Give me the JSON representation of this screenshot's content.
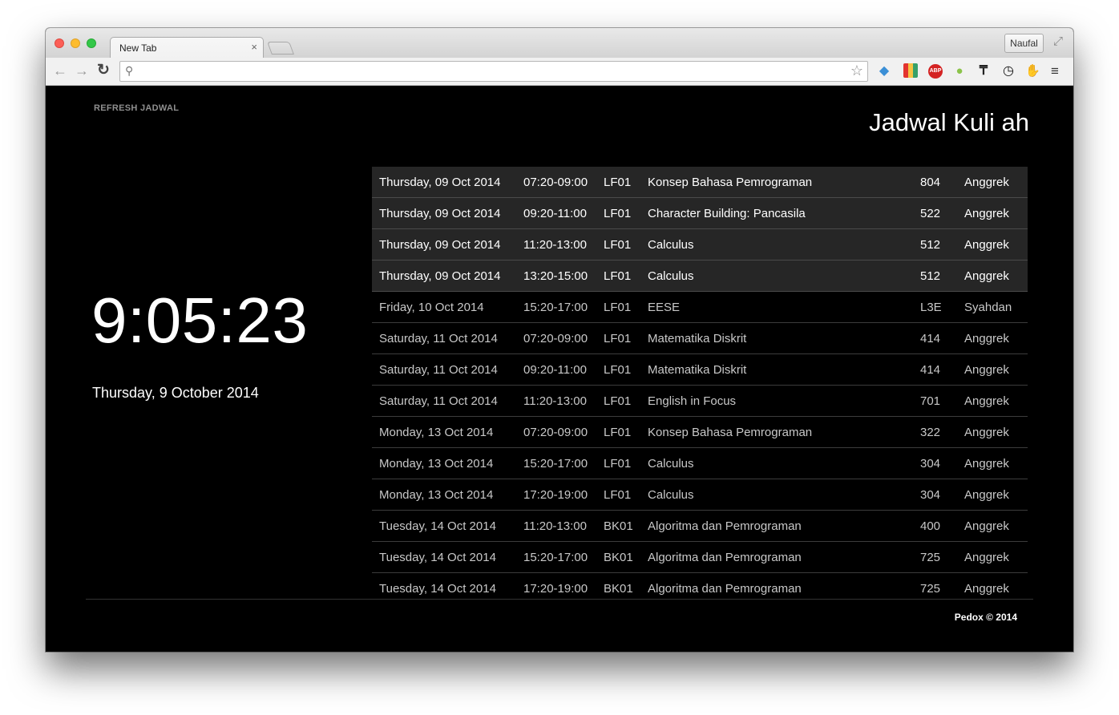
{
  "browser": {
    "tab_title": "New Tab",
    "tab_close": "×",
    "profile_name": "Naufal",
    "address": "",
    "icons": [
      "back-arrow-icon",
      "forward-arrow-icon",
      "reload-icon",
      "search-icon",
      "bookmark-star-icon",
      "fish-extension-icon",
      "grid-extension-icon",
      "adblock-plus-icon",
      "android-icon",
      "tree-extension-icon",
      "clock-extension-icon",
      "hand-extension-icon",
      "menu-icon",
      "fullscreen-icon"
    ],
    "abp_label": "ABP"
  },
  "page": {
    "refresh_label": "REFRESH JADWAL",
    "title": "Jadwal Kuli ah",
    "clock": "9:05:23",
    "date": "Thursday, 9 October 2014",
    "footer": "Pedox © 2014"
  },
  "schedule": [
    {
      "date": "Thursday, 09 Oct 2014",
      "time": "07:20-09:00",
      "class": "LF01",
      "course": "Konsep Bahasa Pemrograman",
      "room": "804",
      "building": "Anggrek",
      "past": true
    },
    {
      "date": "Thursday, 09 Oct 2014",
      "time": "09:20-11:00",
      "class": "LF01",
      "course": "Character Building: Pancasila",
      "room": "522",
      "building": "Anggrek",
      "past": true
    },
    {
      "date": "Thursday, 09 Oct 2014",
      "time": "11:20-13:00",
      "class": "LF01",
      "course": "Calculus",
      "room": "512",
      "building": "Anggrek",
      "past": true
    },
    {
      "date": "Thursday, 09 Oct 2014",
      "time": "13:20-15:00",
      "class": "LF01",
      "course": "Calculus",
      "room": "512",
      "building": "Anggrek",
      "past": true
    },
    {
      "date": "Friday, 10 Oct 2014",
      "time": "15:20-17:00",
      "class": "LF01",
      "course": "EESE",
      "room": "L3E",
      "building": "Syahdan",
      "past": false
    },
    {
      "date": "Saturday, 11 Oct 2014",
      "time": "07:20-09:00",
      "class": "LF01",
      "course": "Matematika Diskrit",
      "room": "414",
      "building": "Anggrek",
      "past": false
    },
    {
      "date": "Saturday, 11 Oct 2014",
      "time": "09:20-11:00",
      "class": "LF01",
      "course": "Matematika Diskrit",
      "room": "414",
      "building": "Anggrek",
      "past": false
    },
    {
      "date": "Saturday, 11 Oct 2014",
      "time": "11:20-13:00",
      "class": "LF01",
      "course": "English in Focus",
      "room": "701",
      "building": "Anggrek",
      "past": false
    },
    {
      "date": "Monday, 13 Oct 2014",
      "time": "07:20-09:00",
      "class": "LF01",
      "course": "Konsep Bahasa Pemrograman",
      "room": "322",
      "building": "Anggrek",
      "past": false
    },
    {
      "date": "Monday, 13 Oct 2014",
      "time": "15:20-17:00",
      "class": "LF01",
      "course": "Calculus",
      "room": "304",
      "building": "Anggrek",
      "past": false
    },
    {
      "date": "Monday, 13 Oct 2014",
      "time": "17:20-19:00",
      "class": "LF01",
      "course": "Calculus",
      "room": "304",
      "building": "Anggrek",
      "past": false
    },
    {
      "date": "Tuesday, 14 Oct 2014",
      "time": "11:20-13:00",
      "class": "BK01",
      "course": "Algoritma dan Pemrograman",
      "room": "400",
      "building": "Anggrek",
      "past": false
    },
    {
      "date": "Tuesday, 14 Oct 2014",
      "time": "15:20-17:00",
      "class": "BK01",
      "course": "Algoritma dan Pemrograman",
      "room": "725",
      "building": "Anggrek",
      "past": false
    },
    {
      "date": "Tuesday, 14 Oct 2014",
      "time": "17:20-19:00",
      "class": "BK01",
      "course": "Algoritma dan Pemrograman",
      "room": "725",
      "building": "Anggrek",
      "past": false
    }
  ]
}
